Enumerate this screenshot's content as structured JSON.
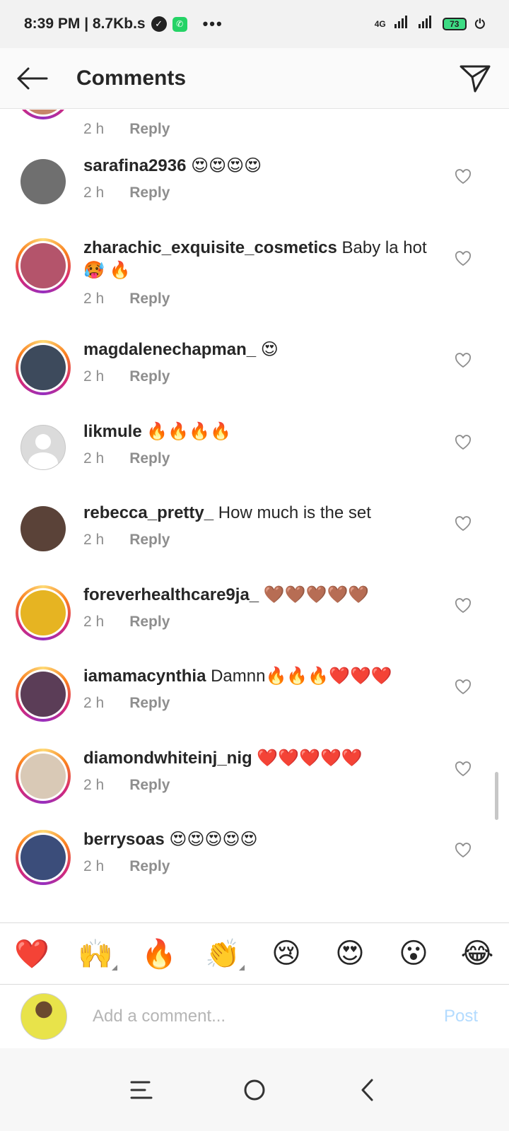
{
  "status_bar": {
    "time": "8:39 PM | 8.7Kb.s",
    "dots": "•••",
    "network": "4G",
    "battery": "73"
  },
  "header": {
    "title": "Comments",
    "icons": {
      "back": "arrow-left-icon",
      "share": "paper-plane-icon"
    }
  },
  "comments": [
    {
      "username": "",
      "text": "",
      "time": "2 h",
      "reply": "Reply",
      "avatar_ring": true,
      "avatar_color": "#c7866a"
    },
    {
      "username": "sarafina2936",
      "text": " 😍😍😍😍",
      "time": "2 h",
      "reply": "Reply",
      "avatar_ring": false,
      "avatar_color": "#6f6f6f"
    },
    {
      "username": "zharachic_exquisite_cosmetics",
      "text": " Baby la hot 🥵 🔥",
      "time": "2 h",
      "reply": "Reply",
      "avatar_ring": true,
      "avatar_color": "#b4546b"
    },
    {
      "username": "magdalenechapman_",
      "text": " 😍",
      "time": "2 h",
      "reply": "Reply",
      "avatar_ring": true,
      "avatar_color": "#3d4a5c"
    },
    {
      "username": "likmule",
      "text": " 🔥🔥🔥🔥",
      "time": "2 h",
      "reply": "Reply",
      "avatar_ring": false,
      "avatar_color": "default"
    },
    {
      "username": "rebecca_pretty_",
      "text": " How much is the set",
      "time": "2 h",
      "reply": "Reply",
      "avatar_ring": false,
      "avatar_color": "#5a4238"
    },
    {
      "username": "foreverhealthcare9ja_",
      "text": " 🤎🤎🤎🤎🤎",
      "time": "2 h",
      "reply": "Reply",
      "avatar_ring": true,
      "avatar_color": "#e6b422"
    },
    {
      "username": "iamamacynthia",
      "text": " Damnn🔥🔥🔥❤️❤️❤️",
      "time": "2 h",
      "reply": "Reply",
      "avatar_ring": true,
      "avatar_color": "#5b3d57"
    },
    {
      "username": "diamondwhiteinj_nig",
      "text": " ❤️❤️❤️❤️❤️",
      "time": "2 h",
      "reply": "Reply",
      "avatar_ring": true,
      "avatar_color": "#d9c9b6"
    },
    {
      "username": "berrysoas",
      "text": " 😍😍😍😍😍",
      "time": "2 h",
      "reply": "Reply",
      "avatar_ring": true,
      "avatar_color": "#3b4d7a"
    }
  ],
  "emoji_bar": [
    {
      "emoji": "❤️",
      "variants": false
    },
    {
      "emoji": "🙌",
      "variants": true
    },
    {
      "emoji": "🔥",
      "variants": false
    },
    {
      "emoji": "👏",
      "variants": true
    },
    {
      "emoji": "😢",
      "variants": false
    },
    {
      "emoji": "😍",
      "variants": false
    },
    {
      "emoji": "😮",
      "variants": false
    },
    {
      "emoji": "😂",
      "variants": false
    }
  ],
  "composer": {
    "placeholder": "Add a comment...",
    "post_label": "Post"
  },
  "colors": {
    "text": "#262626",
    "meta": "#8e8e8e",
    "post_disabled": "#b3dbff",
    "ring_gradient": [
      "#feda75",
      "#fa7e1e",
      "#d62976",
      "#962fbf"
    ]
  }
}
